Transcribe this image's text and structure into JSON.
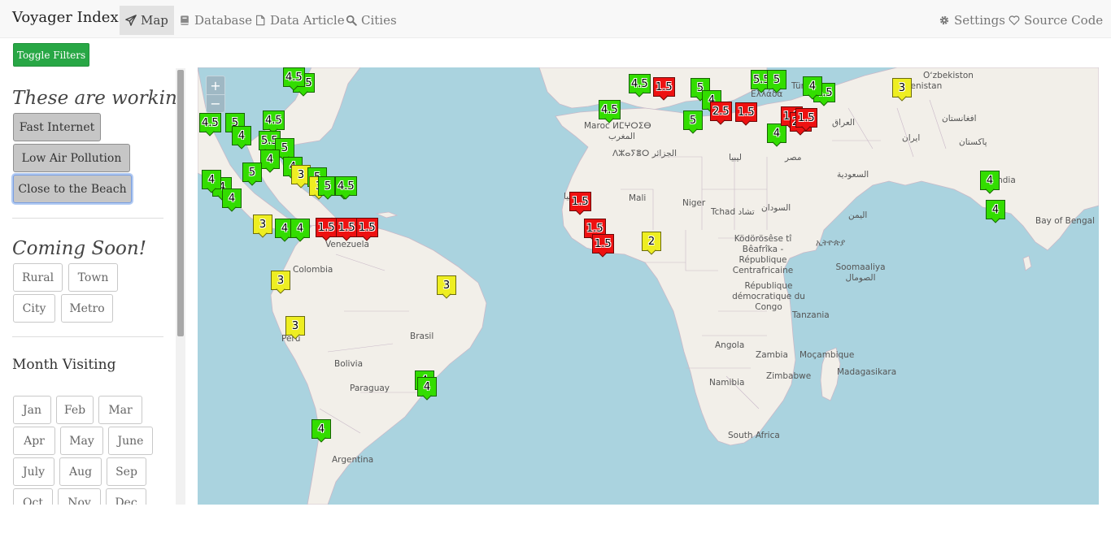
{
  "nav": {
    "brand": "Voyager Index",
    "links": [
      {
        "id": "map",
        "label": "Map",
        "icon": "paper-plane-icon",
        "active": true
      },
      {
        "id": "database",
        "label": "Database",
        "icon": "book-icon"
      },
      {
        "id": "data-article",
        "label": "Data Article",
        "icon": "file-icon"
      },
      {
        "id": "cities",
        "label": "Cities",
        "icon": "search-icon"
      }
    ],
    "right_links": [
      {
        "id": "settings",
        "label": "Settings",
        "icon": "gear-icon"
      },
      {
        "id": "source-code",
        "label": "Source Code",
        "icon": "heart-icon"
      }
    ]
  },
  "sidebar": {
    "toggle_label": "Toggle Filters",
    "working_title": "These are working",
    "working_filters": [
      "Fast Internet",
      "Low Air Pollution",
      "Close to the Beach"
    ],
    "coming_title": "Coming Soon!",
    "sizes": [
      "Rural",
      "Town",
      "City",
      "Metro"
    ],
    "month_heading": "Month Visiting",
    "months": [
      "Jan",
      "Feb",
      "Mar",
      "Apr",
      "May",
      "June",
      "July",
      "Aug",
      "Sep",
      "Oct",
      "Nov",
      "Dec"
    ]
  },
  "map": {
    "zoom_in": "+",
    "zoom_out": "−",
    "labels": [
      "Oʻzbekiston",
      "Armenistan",
      "Türk",
      "Ελλάδα",
      "Maroc ⵍⵎⵖⵔⵉⴱ",
      "المغرب",
      "ⴷⵣⴰⵢⴻⵔ الجزائر",
      "ليبيا",
      "مصر",
      "العراق",
      "ایران",
      "افغانستان",
      "پاکستان",
      "السعودية",
      "India",
      "Bay of Bengal",
      "موريتانيا",
      "Mali",
      "Niger",
      "Tchad تشاد",
      "السودان",
      "اليمن",
      "Ködörösêse tî Bêafrîka - République Centrafricaine",
      "ኢትዮጵያ",
      "Soomaaliya الصومال",
      "République démocratique du Congo",
      "Tanzania",
      "Angola",
      "Zambia",
      "Moçambique",
      "Madagasikara",
      "Namibia",
      "Zimbabwe",
      "South Africa",
      "Venezuela",
      "Colombia",
      "Brasil",
      "Perú",
      "Bolivia",
      "Paraguay",
      "Argentina"
    ],
    "marker_colors": {
      "green": "#33dd00",
      "yellow": "#eeee22",
      "red": "#ee1111"
    },
    "markers": [
      {
        "label": "4.5",
        "color": "green"
      },
      {
        "label": "5",
        "color": "green"
      },
      {
        "label": "4.5",
        "color": "green"
      },
      {
        "label": "4.5",
        "color": "green"
      },
      {
        "label": "4.5",
        "color": "green"
      },
      {
        "label": "5.5",
        "color": "green"
      },
      {
        "label": "5",
        "color": "green"
      },
      {
        "label": "4",
        "color": "green"
      },
      {
        "label": "5",
        "color": "green"
      },
      {
        "label": "4",
        "color": "green"
      },
      {
        "label": "3",
        "color": "yellow"
      },
      {
        "label": "5",
        "color": "green"
      },
      {
        "label": "3",
        "color": "yellow"
      },
      {
        "label": "5",
        "color": "green"
      },
      {
        "label": "4",
        "color": "green"
      },
      {
        "label": "4.5",
        "color": "green"
      },
      {
        "label": "4",
        "color": "green"
      },
      {
        "label": "4",
        "color": "green"
      },
      {
        "label": "4",
        "color": "green"
      },
      {
        "label": "4",
        "color": "green"
      },
      {
        "label": "3",
        "color": "yellow"
      },
      {
        "label": "4",
        "color": "green"
      },
      {
        "label": "4",
        "color": "green"
      },
      {
        "label": "1.5",
        "color": "red"
      },
      {
        "label": "1.5",
        "color": "red"
      },
      {
        "label": "1.5",
        "color": "red"
      },
      {
        "label": "3",
        "color": "yellow"
      },
      {
        "label": "3",
        "color": "yellow"
      },
      {
        "label": "3",
        "color": "yellow"
      },
      {
        "label": "4",
        "color": "green"
      },
      {
        "label": "4",
        "color": "green"
      },
      {
        "label": "4",
        "color": "green"
      },
      {
        "label": "4.5",
        "color": "green"
      },
      {
        "label": "4.5",
        "color": "green"
      },
      {
        "label": "5",
        "color": "green"
      },
      {
        "label": "1.5",
        "color": "red"
      },
      {
        "label": "5",
        "color": "green"
      },
      {
        "label": "4",
        "color": "green"
      },
      {
        "label": "4",
        "color": "green"
      },
      {
        "label": "4.5",
        "color": "green"
      },
      {
        "label": "2.5",
        "color": "red"
      },
      {
        "label": "1.5",
        "color": "red"
      },
      {
        "label": "5.5",
        "color": "green"
      },
      {
        "label": "5",
        "color": "green"
      },
      {
        "label": "4",
        "color": "green"
      },
      {
        "label": "3",
        "color": "yellow"
      },
      {
        "label": "1.5",
        "color": "red"
      },
      {
        "label": "2.5",
        "color": "red"
      },
      {
        "label": "1.5",
        "color": "red"
      },
      {
        "label": "1.5",
        "color": "red"
      },
      {
        "label": "2",
        "color": "yellow"
      },
      {
        "label": "1.5",
        "color": "red"
      },
      {
        "label": "1.5",
        "color": "red"
      },
      {
        "label": "4",
        "color": "green"
      },
      {
        "label": "4",
        "color": "green"
      }
    ]
  }
}
